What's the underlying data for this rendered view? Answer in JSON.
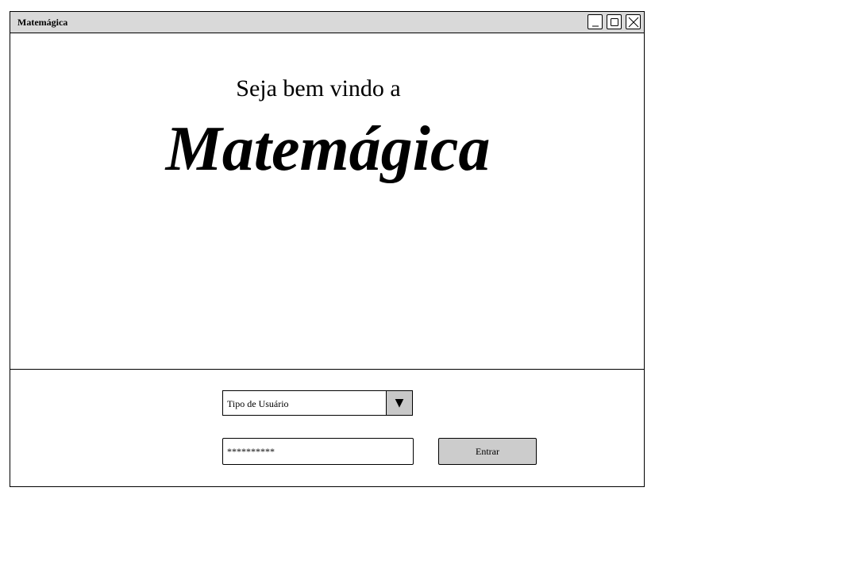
{
  "window": {
    "title": "Matemágica"
  },
  "welcome": {
    "subtitle": "Seja bem vindo a",
    "brand": "Matemágica"
  },
  "form": {
    "user_type_select": {
      "selected": "Tipo de Usuário",
      "arrow": "▼"
    },
    "password_field": {
      "value": "**********"
    },
    "enter_button": {
      "label": "Entrar"
    }
  },
  "icons": {
    "minimize": "minimize-icon",
    "maximize": "maximize-icon",
    "close": "close-icon"
  },
  "colors": {
    "titlebar": "#d9d9d9",
    "button": "#cccccc",
    "dropdown_arrow_bg": "#c8c8c8"
  }
}
